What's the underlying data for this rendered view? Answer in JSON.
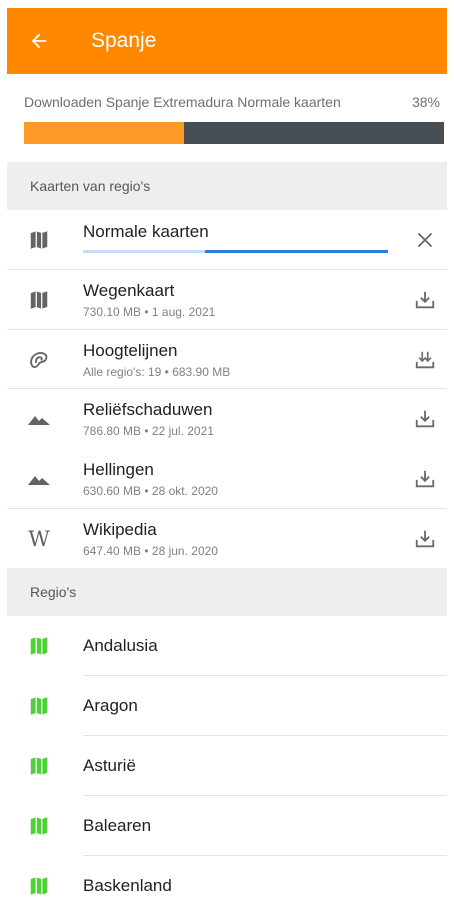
{
  "header": {
    "title": "Spanje"
  },
  "download": {
    "label": "Downloaden Spanje Extremadura Normale kaarten",
    "percent_text": "38%",
    "progress": 0.38
  },
  "sections": {
    "maps_header": "Kaarten van regio's",
    "regions_header": "Regio's"
  },
  "maps": [
    {
      "title": "Normale kaarten",
      "icon": "map-icon",
      "action": "close-icon"
    },
    {
      "title": "Wegenkaart",
      "subtitle": "730.10 MB • 1 aug. 2021",
      "icon": "map-icon",
      "action": "download-icon"
    },
    {
      "title": "Hoogtelijnen",
      "subtitle": "Alle regio's: 19 • 683.90 MB",
      "icon": "contour-icon",
      "action": "download-icon"
    },
    {
      "title": "Reliëfschaduwen",
      "subtitle": "786.80 MB • 22 jul. 2021",
      "icon": "mountain-icon",
      "action": "download-icon"
    },
    {
      "title": "Hellingen",
      "subtitle": "630.60 MB • 28 okt. 2020",
      "icon": "mountain-icon",
      "action": "download-icon"
    },
    {
      "title": "Wikipedia",
      "subtitle": "647.40 MB • 28 jun. 2020",
      "icon": "wikipedia-icon",
      "icon_glyph": "W",
      "action": "download-icon"
    }
  ],
  "regions": [
    {
      "title": "Andalusia"
    },
    {
      "title": "Aragon"
    },
    {
      "title": "Asturië"
    },
    {
      "title": "Balearen"
    },
    {
      "title": "Baskenland"
    }
  ],
  "colors": {
    "accent": "#ff8800",
    "progress_fill": "#ff9a2a",
    "progress_track": "#474f55",
    "region_icon": "#4cd137",
    "row_progress": "#2f7de1"
  }
}
